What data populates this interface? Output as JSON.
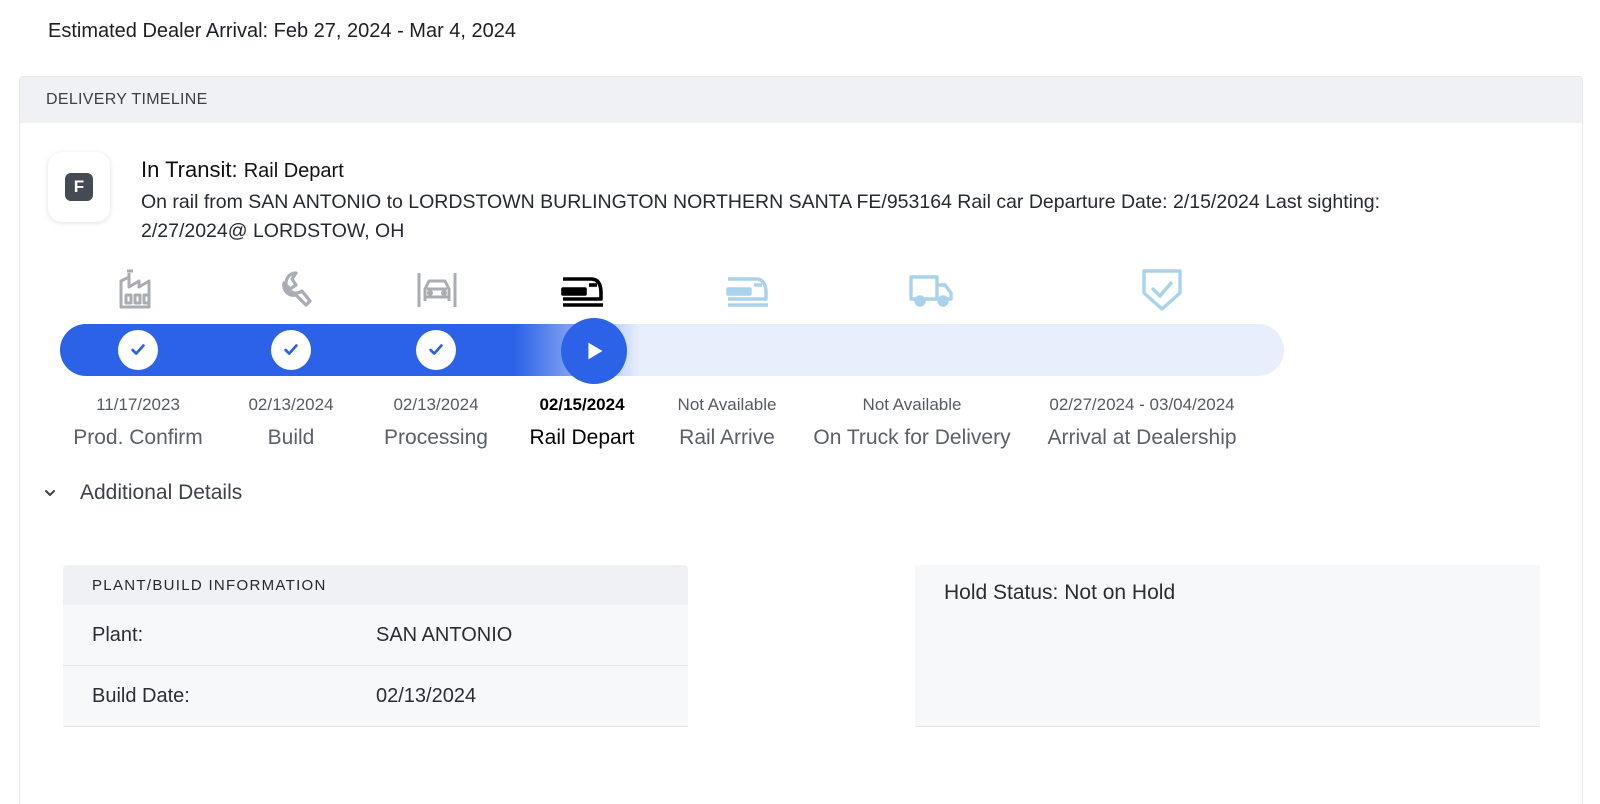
{
  "estimated_arrival": "Estimated Dealer Arrival: Feb 27, 2024 - Mar 4, 2024",
  "timeline": {
    "header": "DELIVERY TIMELINE",
    "badge_letter": "F",
    "status_title": "In Transit:",
    "status_sub": "Rail Depart",
    "status_description": "On rail from SAN ANTONIO to LORDSTOWN BURLINGTON NORTHERN SANTA FE/953164 Rail car Departure Date: 2/15/2024 Last sighting: 2/27/2024@ LORDSTOW, OH",
    "progress_current_step": 4,
    "progress_total_steps": 7,
    "stages": [
      {
        "date": "11/17/2023",
        "name": "Prod. Confirm",
        "icon": "factory-icon",
        "state": "complete"
      },
      {
        "date": "02/13/2024",
        "name": "Build",
        "icon": "wrench-icon",
        "state": "complete"
      },
      {
        "date": "02/13/2024",
        "name": "Processing",
        "icon": "car-processing-icon",
        "state": "complete"
      },
      {
        "date": "02/15/2024",
        "name": "Rail Depart",
        "icon": "train-icon",
        "state": "current"
      },
      {
        "date": "Not Available",
        "name": "Rail Arrive",
        "icon": "train-arrive-icon",
        "state": "pending"
      },
      {
        "date": "Not Available",
        "name": "On Truck for Delivery",
        "icon": "truck-icon",
        "state": "pending"
      },
      {
        "date": "02/27/2024 - 03/04/2024",
        "name": "Arrival at Dealership",
        "icon": "shield-check-icon",
        "state": "pending"
      }
    ]
  },
  "additional_details": {
    "label": "Additional Details",
    "plant_info": {
      "header": "PLANT/BUILD INFORMATION",
      "rows": [
        {
          "key": "Plant:",
          "value": "SAN ANTONIO"
        },
        {
          "key": "Build Date:",
          "value": "02/13/2024"
        }
      ]
    },
    "hold_status": "Hold Status: Not on Hold"
  },
  "colors": {
    "progress_blue": "#2b62e8",
    "track_pending": "#e8eefc",
    "icon_done": "#a9acb2",
    "icon_current": "#000000",
    "icon_pending": "#a9d3ec"
  }
}
